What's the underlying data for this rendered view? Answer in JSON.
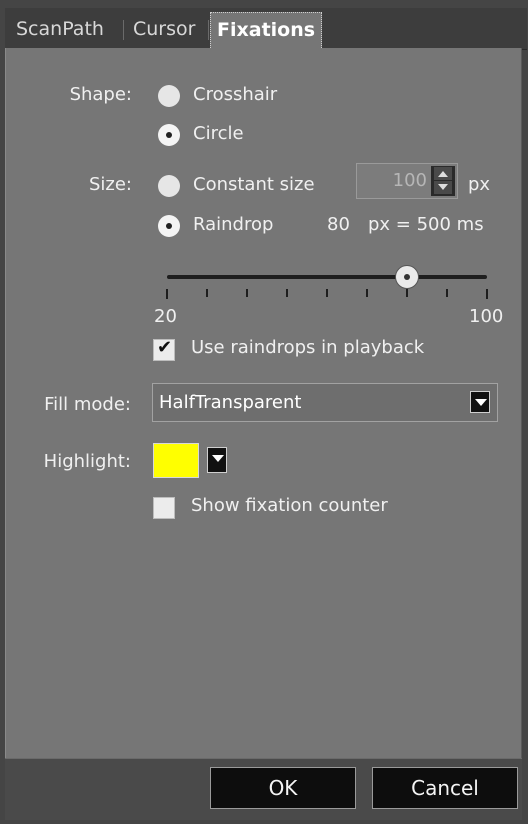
{
  "tabs": [
    {
      "label": "ScanPath",
      "active": false
    },
    {
      "label": "Cursor",
      "active": false
    },
    {
      "label": "Fixations",
      "active": true
    }
  ],
  "shape": {
    "label": "Shape:",
    "options": [
      "Crosshair",
      "Circle"
    ],
    "selected": "Circle"
  },
  "size": {
    "label": "Size:",
    "constant_label": "Constant size",
    "constant_value": "100",
    "constant_unit": "px",
    "raindrop_label": "Raindrop",
    "raindrop_value": "80",
    "raindrop_desc": "px = 500 ms",
    "selected": "Raindrop"
  },
  "slider": {
    "min_label": "20",
    "max_label": "100",
    "min": 20,
    "max": 100,
    "value": 80
  },
  "use_raindrops": {
    "label": "Use raindrops in playback",
    "checked": true
  },
  "fill_mode": {
    "label": "Fill mode:",
    "value": "HalfTransparent"
  },
  "highlight": {
    "label": "Highlight:",
    "color": "#ffff00"
  },
  "show_counter": {
    "label": "Show fixation counter",
    "checked": false
  },
  "buttons": {
    "ok": "OK",
    "cancel": "Cancel"
  }
}
